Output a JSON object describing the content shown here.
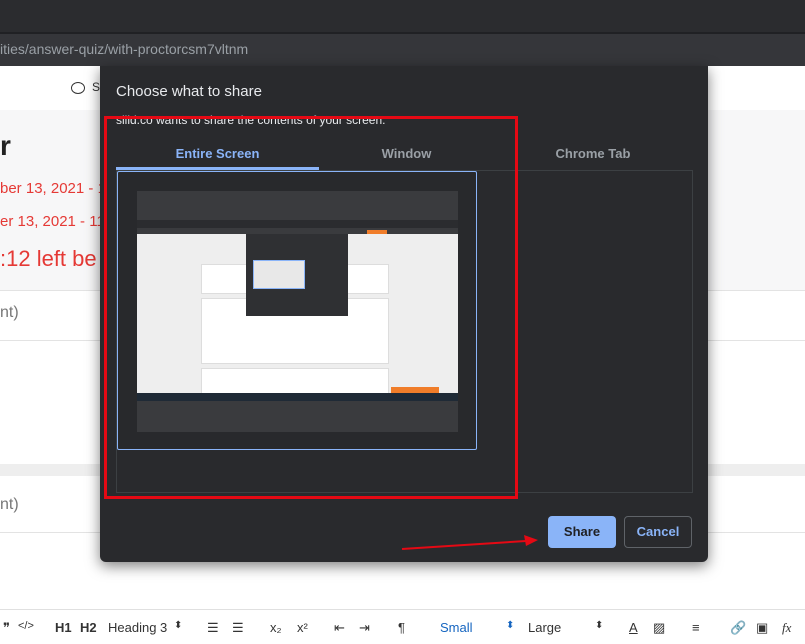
{
  "browser": {
    "url": "ities/answer-quiz/with-proctorcsm7vltnm"
  },
  "page": {
    "nav_letter": "S",
    "title": "r",
    "date_start": "ber 13, 2021 - 1",
    "date_end": "er 13, 2021 - 11",
    "time_left": ":12 left be",
    "section1": "nt)",
    "section2": "nt)"
  },
  "dialog": {
    "title": "Choose what to share",
    "subtitle": "sliid.co wants to share the contents of your screen.",
    "tabs": [
      {
        "label": "Entire Screen",
        "active": true
      },
      {
        "label": "Window",
        "active": false
      },
      {
        "label": "Chrome Tab",
        "active": false
      }
    ],
    "share_label": "Share",
    "cancel_label": "Cancel"
  },
  "editor_toolbar": {
    "h1": "H1",
    "h2": "H2",
    "heading_select": "Heading 3",
    "small_select": "Small",
    "large_select": "Large"
  },
  "colors": {
    "dialog_bg": "#292a2d",
    "accent": "#8ab4f8",
    "annotation_red": "#e50914",
    "page_red": "#e53935"
  }
}
